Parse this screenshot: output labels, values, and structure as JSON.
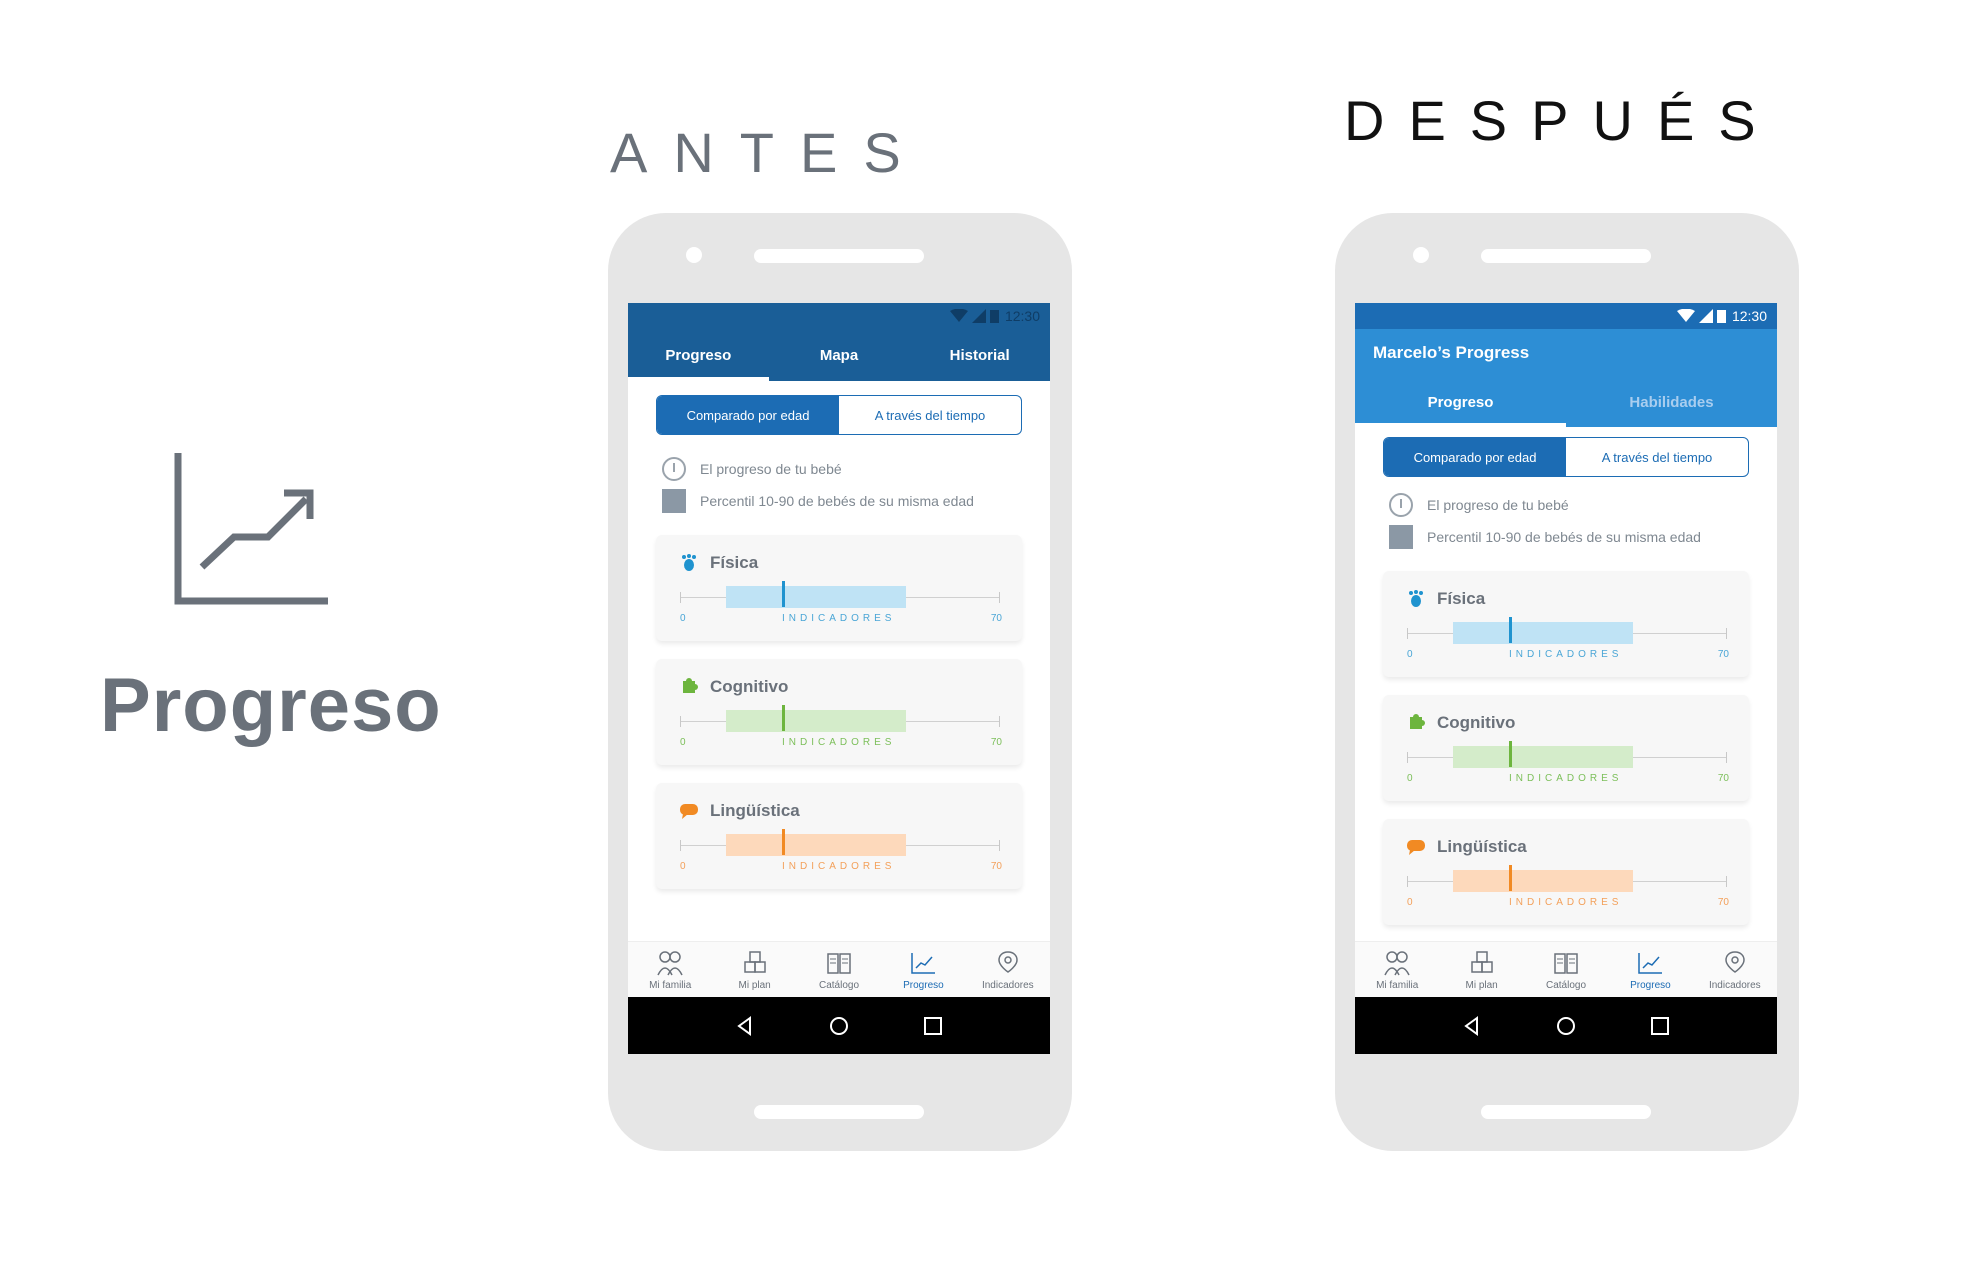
{
  "left": {
    "title": "Progreso",
    "icon": "chart-up-icon"
  },
  "headings": {
    "before": "ANTES",
    "after": "DESPUÉS"
  },
  "status_time": "12:30",
  "before": {
    "tabs": [
      "Progreso",
      "Mapa",
      "Historial"
    ],
    "segment": [
      "Comparado por edad",
      "A través del tiempo"
    ],
    "legend": [
      "El progreso de tu bebé",
      "Percentil 10-90 de bebés de su misma edad"
    ],
    "cards": [
      {
        "title": "Física",
        "min": "0",
        "max": "70",
        "axis": "INDICADORES",
        "icon": "footprint-icon",
        "color": "#1f93cf"
      },
      {
        "title": "Cognitivo",
        "min": "0",
        "max": "70",
        "axis": "INDICADORES",
        "icon": "puzzle-icon",
        "color": "#6db53e"
      },
      {
        "title": "Lingüística",
        "min": "0",
        "max": "70",
        "axis": "INDICADORES",
        "icon": "speech-bubble-icon",
        "color": "#f18a23"
      }
    ]
  },
  "after": {
    "appbar_title": "Marcelo’s Progress",
    "tabs": [
      "Progreso",
      "Habilidades"
    ],
    "segment": [
      "Comparado por edad",
      "A través del tiempo"
    ],
    "legend": [
      "El progreso de tu bebé",
      "Percentil 10-90 de bebés de su misma edad"
    ],
    "cards": [
      {
        "title": "Física",
        "min": "0",
        "max": "70",
        "axis": "INDICADORES"
      },
      {
        "title": "Cognitivo",
        "min": "0",
        "max": "70",
        "axis": "INDICADORES"
      },
      {
        "title": "Lingüística",
        "min": "0",
        "max": "70",
        "axis": "INDICADORES"
      }
    ]
  },
  "bottom_nav": [
    "Mi familia",
    "Mi plan",
    "Catálogo",
    "Progreso",
    "Indicadores"
  ],
  "colors": {
    "primary_dark": "#1a5e97",
    "primary": "#1c6cb4",
    "primary_light": "#2d8ed5"
  }
}
